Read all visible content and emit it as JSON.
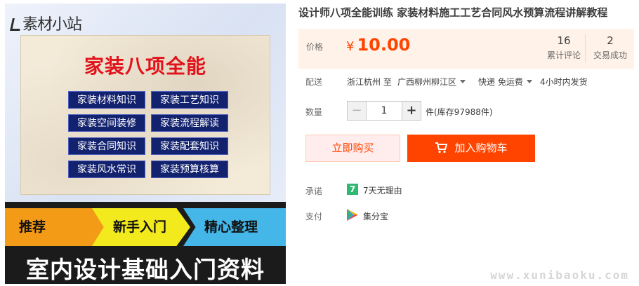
{
  "product_image": {
    "watermark_logo": "素材小站",
    "main_title": "家装八项全能",
    "topics": [
      "家装材料知识",
      "家装工艺知识",
      "家装空间装修",
      "家装流程解读",
      "家装合同知识",
      "家装配套知识",
      "家装风水常识",
      "家装预算核算"
    ],
    "tags": [
      "推荐",
      "新手入门",
      "精心整理"
    ],
    "banner_text": "室内设计基础入门资料"
  },
  "product": {
    "title": "设计师八项全能训练 家装材料施工工艺合同风水预算流程讲解教程"
  },
  "price": {
    "label": "价格",
    "currency": "¥",
    "value": "10.00",
    "reviews_count": "16",
    "reviews_label": "累计评论",
    "sales_count": "2",
    "sales_label": "交易成功"
  },
  "delivery": {
    "label": "配送",
    "origin": "浙江杭州 至",
    "destination": "广西柳州柳江区",
    "method": "快递 免运费",
    "ship_time": "4小时内发货"
  },
  "quantity": {
    "label": "数量",
    "minus": "−",
    "plus": "+",
    "value": "1",
    "stock": "件(库存97988件)"
  },
  "actions": {
    "buy_now": "立即购买",
    "add_to_cart": "加入购物车"
  },
  "promise": {
    "label": "承诺",
    "icon_text": "7",
    "text": "7天无理由"
  },
  "payment": {
    "label": "支付",
    "method": "集分宝"
  },
  "site_watermark": "www.xunibaoku.com",
  "colors": {
    "accent": "#ff4400",
    "price_bg": "#fff2e8",
    "buy_now_bg": "#ffeded",
    "promise_green": "#2eb872"
  }
}
